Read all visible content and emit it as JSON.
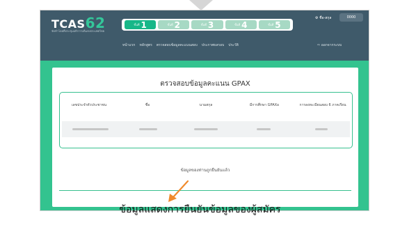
{
  "logo": {
    "text": "TCAS",
    "number": "62",
    "subtitle": "จัดทำโดยที่ประชุมอธิการบดีแห่งประเทศไทย"
  },
  "steps": [
    {
      "label": "ขั้นที่",
      "number": "1",
      "active": true
    },
    {
      "label": "ขั้นที่",
      "number": "2",
      "active": false
    },
    {
      "label": "ขั้นที่",
      "number": "3",
      "active": false
    },
    {
      "label": "ขั้นที่",
      "number": "4",
      "active": false
    },
    {
      "label": "ขั้นที่",
      "number": "5",
      "active": false
    }
  ],
  "nav": [
    "หน้าแรก",
    "หลักสูตร",
    "ตรวจสอบข้อมูลคะแนนสอบ",
    "ประกาศผลรอบ",
    "ประวัติ"
  ],
  "user": {
    "label": "⚙ ชื่อ-สกุล",
    "box": "0000"
  },
  "logout": "⇨ ออกจากระบบ",
  "card": {
    "title": "ตรวจสอบข้อมูลคะแนน GPAX",
    "headers": [
      "เลขประจำตัวประชาชน",
      "ชื่อ",
      "นามสกุล",
      "มีการศึกษา GPAXอ",
      "การลงทะเบียนสอบ 6 ภาคเรียน"
    ],
    "confirm_text": "ข้อมูลของท่านถูกยืนยันแล้ว"
  },
  "caption": "ข้อมูลแสดงการยืนยันข้อมูลของผู้สมัคร",
  "colors": {
    "header": "#3f5a6a",
    "accent": "#17b788",
    "background_green": "#33c38f",
    "arrow": "#f08a2c"
  }
}
